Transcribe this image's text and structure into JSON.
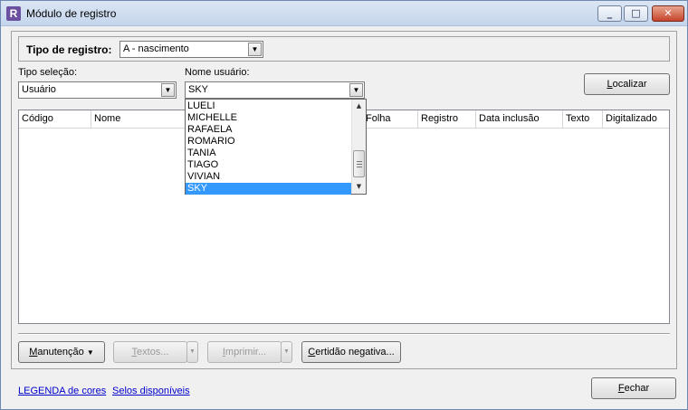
{
  "window": {
    "title": "Módulo de registro",
    "icon_letter": "R"
  },
  "tipo_registro": {
    "label": "Tipo de registro:",
    "value": "A - nascimento"
  },
  "tipo_selecao": {
    "label": "Tipo seleção:",
    "value": "Usuário"
  },
  "nome_usuario": {
    "label": "Nome usuário:",
    "value": "SKY",
    "options": [
      "LUELI",
      "MICHELLE",
      "RAFAELA",
      "ROMARIO",
      "TANIA",
      "TIAGO",
      "VIVIAN",
      "SKY"
    ],
    "selected": "SKY"
  },
  "localizar": {
    "prefix": "",
    "underlined": "L",
    "rest": "ocalizar"
  },
  "grid": {
    "columns": [
      "Código",
      "Nome",
      "Folha",
      "Registro",
      "Data inclusão",
      "Texto",
      "Digitalizado"
    ]
  },
  "actions": {
    "manutencao": {
      "u": "M",
      "rest": "anutenção",
      "arrow": "▼"
    },
    "textos": {
      "u": "T",
      "rest": "extos..."
    },
    "imprimir": {
      "u": "I",
      "rest": "mprimir..."
    },
    "certidao": {
      "u": "C",
      "rest": "ertidão negativa..."
    }
  },
  "footer": {
    "legenda": "LEGENDA de cores",
    "selos": "Selos disponíveis",
    "fechar": {
      "u": "F",
      "rest": "echar"
    }
  },
  "icons": {
    "minimize": "minimize-icon",
    "maximize": "maximize-icon",
    "close": "close-icon",
    "dropdown": "chevron-down-icon"
  }
}
